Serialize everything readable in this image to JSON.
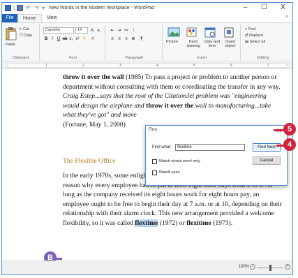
{
  "window": {
    "title": "New Words in the Modern Workplace - WordPad",
    "minimize": "–",
    "maximize": "☐",
    "close": "X"
  },
  "menu": {
    "file": "File",
    "home": "Home",
    "view": "View"
  },
  "ribbon": {
    "clipboard": {
      "label": "Clipboard",
      "paste": "Paste",
      "cut": "Cut",
      "copy": "Copy"
    },
    "font": {
      "label": "Font",
      "font_name": "Cambria",
      "font_size": "14"
    },
    "paragraph": {
      "label": "Paragraph"
    },
    "insert": {
      "label": "Insert",
      "picture": "Picture",
      "paint": "Paint drawing",
      "datetime": "Date and time",
      "object": "Insert object"
    },
    "editing": {
      "label": "Editing",
      "find": "Find",
      "replace": "Replace",
      "select_all": "Select all"
    }
  },
  "ruler": {
    "numbers": [
      "1",
      "2",
      "3",
      "4",
      "5",
      "6",
      "7"
    ]
  },
  "document": {
    "entry1_term": "throw it over the wall",
    "entry1_text": " (1985) To pass a project or problem to another person or department without consulting with them or coordinating the transfer in any way. ",
    "entry1_quote_a": "Craig Estep...says that the root of the CitationJet problem was \"engineering would design the airplane and ",
    "entry1_quote_term": "throw it over the",
    "entry1_quote_b": " wall to manufacturing...take what they've got\" and move",
    "entry1_source": "(Fortune, May 1, 2000)",
    "section_heading": "The Flexible Office",
    "para2_text": "In the early 1970s, some enlightened employers realized that there was no earthly reason why every employee had to put in their eight-hour days from 9 to 5. As long as the company received its eight hours work for eight hours pay, an employee ought to be free to begin their day at 7 a.m. or at 10, depending on their relationship with their alarm clock. This new arrangement provided a welcome flexibility, so it was called ",
    "term_highlighted": "flextime",
    "term_year1": " (1972) or ",
    "term_alt": "flexitime",
    "term_year2": " (1973)."
  },
  "find_dialog": {
    "title": "Find",
    "find_what_label": "Find what:",
    "find_what_value": "flextime",
    "find_next": "Find Next",
    "cancel": "Cancel",
    "match_whole": "Match whole word only",
    "match_case": "Match case",
    "close_glyph": "×"
  },
  "statusbar": {
    "zoom": "100%",
    "zoom_minus": "−",
    "zoom_plus": "+"
  },
  "callouts": {
    "step5": "5",
    "step4": "4",
    "stepB": "B"
  },
  "colors": {
    "accent": "#1b62b8",
    "heading": "#b07a1c",
    "callout_red": "#d0243a",
    "callout_purple": "#7a5fb8",
    "highlight": "#b9d7f5"
  }
}
